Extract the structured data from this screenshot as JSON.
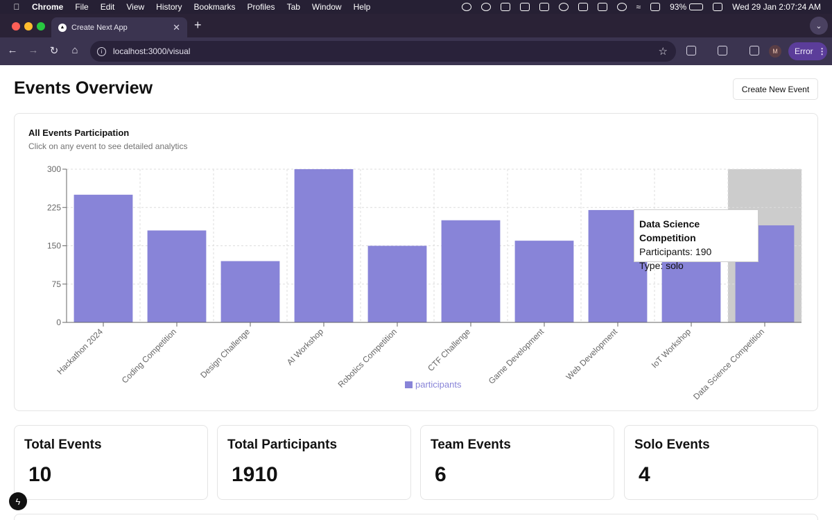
{
  "menubar": {
    "app_name": "Chrome",
    "items": [
      "File",
      "Edit",
      "View",
      "History",
      "Bookmarks",
      "Profiles",
      "Tab",
      "Window",
      "Help"
    ],
    "battery": "93%",
    "battery_level": 0.93,
    "datetime": "Wed 29 Jan  2:07:24 AM"
  },
  "browser": {
    "tab_title": "Create Next App",
    "tab_favicon": "▲",
    "url": "localhost:3000/visual",
    "profile_initial": "M",
    "error_label": "Error"
  },
  "page": {
    "title": "Events Overview",
    "create_button": "Create New Event"
  },
  "chart_card": {
    "title": "All Events Participation",
    "subtitle": "Click on any event to see detailed analytics"
  },
  "tooltip": {
    "title": "Data Science Competition",
    "participants": "Participants: 190",
    "type": "Type: solo"
  },
  "chart_data": {
    "type": "bar",
    "categories": [
      "Hackathon 2024",
      "Coding Competition",
      "Design Challenge",
      "AI Workshop",
      "Robotics Competition",
      "CTF Challenge",
      "Game Development",
      "Web Development",
      "IoT Workshop",
      "Data Science Competition"
    ],
    "series": [
      {
        "name": "participants",
        "values": [
          250,
          180,
          120,
          300,
          150,
          200,
          160,
          220,
          140,
          190
        ],
        "color": "#8884d8"
      }
    ],
    "yticks": [
      0,
      75,
      150,
      225,
      300
    ],
    "ylim": [
      0,
      300
    ],
    "grid": true,
    "legend": "bottom",
    "highlighted_category": "Data Science Competition"
  },
  "stats": [
    {
      "label": "Total Events",
      "value": "10"
    },
    {
      "label": "Total Participants",
      "value": "1910"
    },
    {
      "label": "Team Events",
      "value": "6"
    },
    {
      "label": "Solo Events",
      "value": "4"
    }
  ]
}
